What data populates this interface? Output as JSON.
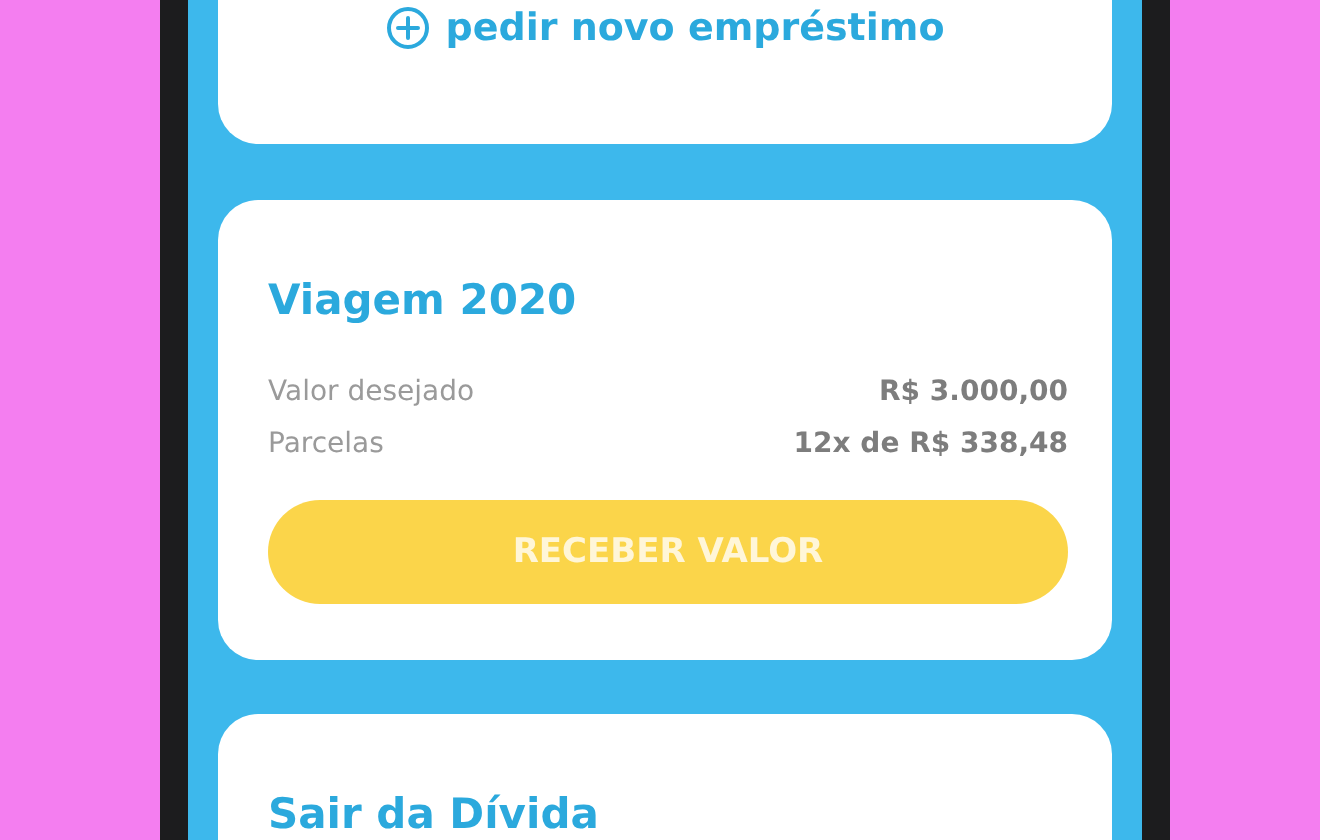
{
  "loan_link": {
    "label": "pedir novo empréstimo"
  },
  "loans": [
    {
      "title": "Viagem 2020",
      "rows": [
        {
          "label": "Valor desejado",
          "value": "R$ 3.000,00"
        },
        {
          "label": "Parcelas",
          "value": "12x de R$ 338,48"
        }
      ],
      "button": "RECEBER VALOR"
    },
    {
      "title": "Sair da Dívida"
    }
  ]
}
